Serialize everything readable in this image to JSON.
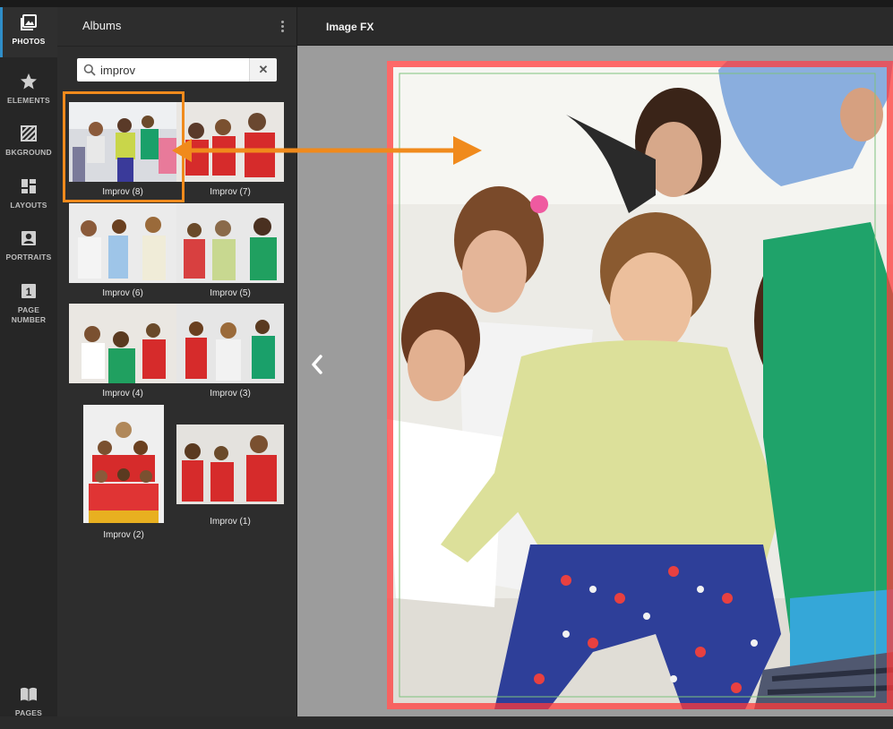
{
  "rail": {
    "items": [
      {
        "label": "PHOTOS",
        "icon": "photos-icon"
      },
      {
        "label": "ELEMENTS",
        "icon": "star-icon"
      },
      {
        "label": "BKGROUND",
        "icon": "background-icon"
      },
      {
        "label": "LAYOUTS",
        "icon": "layouts-icon"
      },
      {
        "label": "PORTRAITS",
        "icon": "portrait-icon"
      },
      {
        "label": "PAGE NUMBER",
        "icon": "page-number-icon",
        "badge": "1"
      },
      {
        "label": "PAGES",
        "icon": "book-icon"
      }
    ]
  },
  "panel": {
    "title": "Albums",
    "search": {
      "value": "improv",
      "placeholder": "Search"
    },
    "photos": [
      {
        "caption": "Improv (8)"
      },
      {
        "caption": "Improv (7)"
      },
      {
        "caption": "Improv (6)"
      },
      {
        "caption": "Improv (5)"
      },
      {
        "caption": "Improv (4)"
      },
      {
        "caption": "Improv (3)"
      },
      {
        "caption": "Improv (2)"
      },
      {
        "caption": "Improv (1)"
      }
    ]
  },
  "editor": {
    "title": "Image FX"
  },
  "colors": {
    "accent": "#2f8ec9",
    "highlight": "#f08a1c",
    "page_border": "#ff3a3a"
  }
}
